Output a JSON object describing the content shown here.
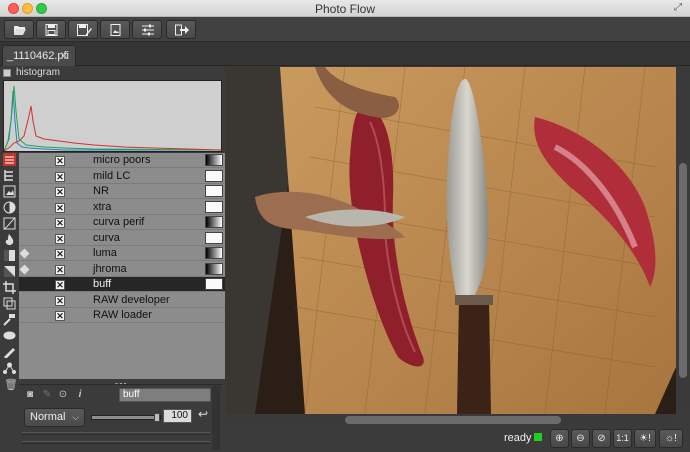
{
  "window": {
    "title": "Photo Flow"
  },
  "toolbar": {
    "buttons": [
      {
        "name": "open",
        "icon": "folder-open-icon"
      },
      {
        "name": "save",
        "icon": "save-icon"
      },
      {
        "name": "save-as",
        "icon": "save-as-icon"
      },
      {
        "name": "export",
        "icon": "export-image-icon"
      },
      {
        "name": "settings",
        "icon": "sliders-icon"
      },
      {
        "name": "exit",
        "icon": "exit-icon"
      }
    ]
  },
  "tabs": [
    {
      "label": "_1110462.pfi",
      "close": "✕"
    }
  ],
  "histogram": {
    "label": "histogram"
  },
  "layers": [
    {
      "name": "micro poors",
      "mask": "grad",
      "marker": false,
      "selected": false
    },
    {
      "name": "mild LC",
      "mask": "white",
      "marker": false,
      "selected": false
    },
    {
      "name": "NR",
      "mask": "white",
      "marker": false,
      "selected": false
    },
    {
      "name": "xtra",
      "mask": "white",
      "marker": false,
      "selected": false
    },
    {
      "name": "curva perif",
      "mask": "grad",
      "marker": false,
      "selected": false
    },
    {
      "name": "curva",
      "mask": "white",
      "marker": false,
      "selected": false
    },
    {
      "name": "luma",
      "mask": "grad",
      "marker": true,
      "selected": false
    },
    {
      "name": "jhroma",
      "mask": "grad",
      "marker": true,
      "selected": false
    },
    {
      "name": "buff",
      "mask": "white",
      "marker": false,
      "selected": true
    },
    {
      "name": "RAW developer",
      "mask": "none",
      "marker": false,
      "selected": false
    },
    {
      "name": "RAW loader",
      "mask": "none",
      "marker": false,
      "selected": false
    }
  ],
  "layer_props": {
    "name_value": "buff",
    "blend_mode": "Normal",
    "opacity": "100",
    "opacity_level": 1.0,
    "info_icon": "i"
  },
  "status": {
    "text": "ready",
    "led_color": "#1fd11f",
    "zoom_fit_label": "1:1",
    "zoom_buttons": [
      "zoom-in-icon",
      "zoom-out-icon",
      "zoom-fit-icon",
      "zoom-actual-icon",
      "exposure-high-icon",
      "exposure-low-icon"
    ]
  }
}
